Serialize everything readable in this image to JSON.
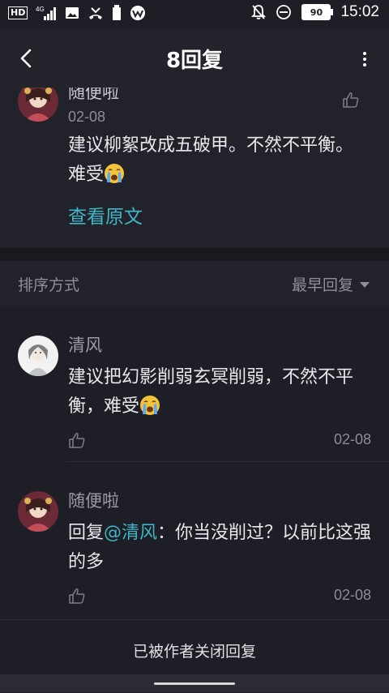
{
  "status_bar": {
    "time": "15:02",
    "battery": "90",
    "network": "4G",
    "hd": "HD",
    "icons_left": [
      "hd-icon",
      "signal-icon",
      "image-icon",
      "missed-call-icon",
      "battery-saver-icon",
      "app-icon"
    ],
    "icons_right": [
      "mute-icon",
      "dnd-icon",
      "battery-icon"
    ]
  },
  "header": {
    "title": "8回复",
    "back_icon": "chevron-left-icon",
    "more_icon": "more-vert-icon"
  },
  "top_comment": {
    "author": "随便啦",
    "date": "02-08",
    "text": "建议柳絮改成五破甲。不然不平衡。难受",
    "emoji": "crying-face",
    "view_original": "查看原文"
  },
  "sort": {
    "label": "排序方式",
    "value": "最早回复"
  },
  "replies": [
    {
      "author": "清风",
      "text": "建议把幻影削弱玄冥削弱，不然不平衡，难受",
      "emoji": "crying-face",
      "date": "02-08"
    },
    {
      "author": "随便啦",
      "prefix": "回复",
      "mention": "@清风",
      "text": "：你当没削过？以前比这强的多",
      "date": "02-08"
    }
  ],
  "footer": {
    "text": "已被作者关闭回复"
  },
  "colors": {
    "background": "#1e1f26",
    "accent_link": "#3fb5c8",
    "muted_text": "#8e8f97"
  }
}
